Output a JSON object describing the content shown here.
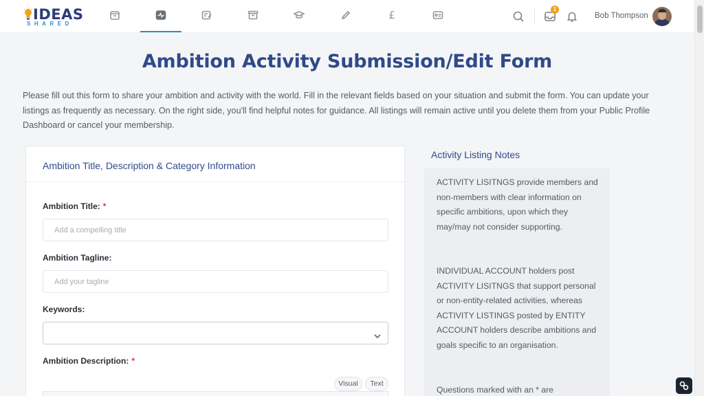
{
  "logo": {
    "main": "IDEAS",
    "sub": "SHARED"
  },
  "nav": {
    "icons": [
      "storefront-icon",
      "activity-icon",
      "edit-note-icon",
      "archive-icon",
      "graduation-cap-icon",
      "pencil-icon",
      "pound-icon",
      "id-card-icon"
    ],
    "pound_glyph": "£",
    "active": "activity-icon"
  },
  "header": {
    "inbox_badge": "1",
    "user_name": "Bob Thompson"
  },
  "page": {
    "title": "Ambition Activity Submission/Edit Form",
    "intro": "Please fill out this form to share your ambition and activity with the world. Fill in the relevant fields based on your situation and submit the form. You can update your listings as frequently as necessary. On the right side, you'll find helpful notes for guidance. All listings will remain active until you delete them from your Public Profile Dashboard or cancel your membership."
  },
  "form": {
    "section_title": "Ambition Title, Description & Category Information",
    "title_label": "Ambition Title:",
    "title_placeholder": "Add a compelling title",
    "tagline_label": "Ambition Tagline:",
    "tagline_placeholder": "Add your tagline",
    "keywords_label": "Keywords:",
    "keywords_value": "",
    "description_label": "Ambition Description:",
    "required_mark": "*",
    "editor_tabs": {
      "visual": "Visual",
      "text": "Text"
    }
  },
  "notes": {
    "title": "Activity Listing Notes",
    "paragraphs": [
      "ACTIVITY LISITNGS provide members and non-members with clear information on specific ambitions, upon which they may/may not consider supporting.",
      "INDIVIDUAL ACCOUNT holders post ACTIVITY LISITNGS that support personal or non-entity-related activities, whereas ACTIVITY LISTINGS posted by ENTITY ACCOUNT holders describe ambitions and goals specific to an organisation.",
      "Questions marked with an * are"
    ]
  },
  "colors": {
    "brand_blue": "#2f4a8a",
    "accent": "#2e8bc4",
    "badge": "#f5a11b",
    "required": "#e0343a"
  }
}
